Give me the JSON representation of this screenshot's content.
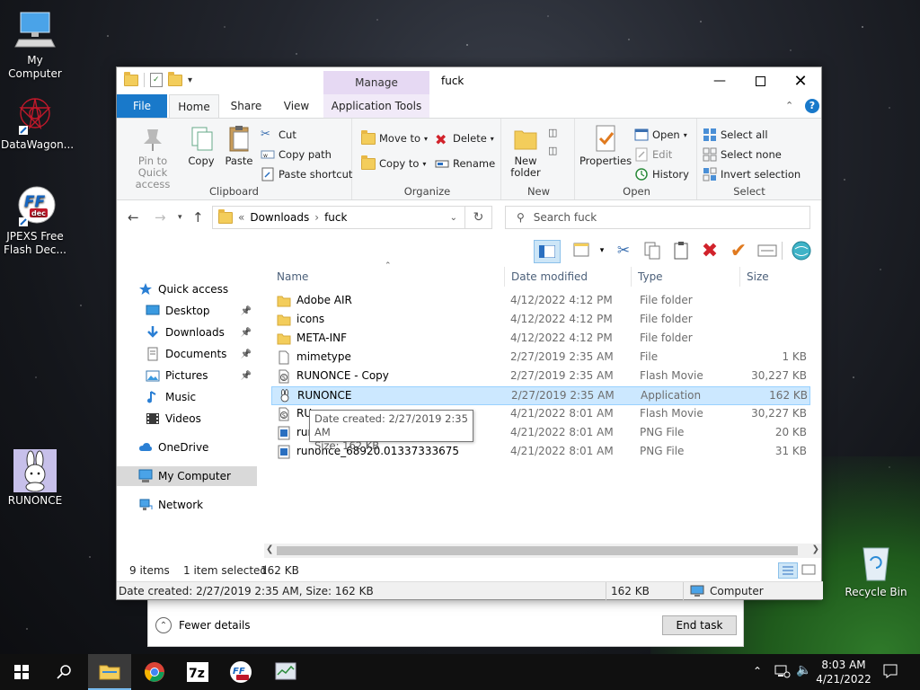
{
  "desktop": {
    "icons": [
      {
        "label": "My Computer",
        "icon": "computer-icon"
      },
      {
        "label": "DataWagon...",
        "icon": "datawagon-icon"
      },
      {
        "label": "JPEXS Free Flash Dec...",
        "icon": "ffdec-icon"
      },
      {
        "label": "RUNONCE",
        "icon": "bunny-icon"
      },
      {
        "label": "Recycle Bin",
        "icon": "recycle-bin-icon"
      }
    ]
  },
  "taskmgr": {
    "fewer_details": "Fewer details",
    "end_task": "End task"
  },
  "window": {
    "title": "fuck",
    "manage": "Manage",
    "tabs": {
      "file": "File",
      "home": "Home",
      "share": "Share",
      "view": "View",
      "app_tools": "Application Tools"
    },
    "ribbon": {
      "clipboard": {
        "label": "Clipboard",
        "pin": "Pin to Quick access",
        "copy": "Copy",
        "paste": "Paste",
        "cut": "Cut",
        "copy_path": "Copy path",
        "paste_shortcut": "Paste shortcut"
      },
      "organize": {
        "label": "Organize",
        "move_to": "Move to",
        "copy_to": "Copy to",
        "delete": "Delete",
        "rename": "Rename"
      },
      "new": {
        "label": "New",
        "new_folder": "New folder"
      },
      "open": {
        "label": "Open",
        "properties": "Properties",
        "open": "Open",
        "edit": "Edit",
        "history": "History"
      },
      "select": {
        "label": "Select",
        "select_all": "Select all",
        "select_none": "Select none",
        "invert": "Invert selection"
      }
    },
    "address": {
      "crumbs": [
        "Downloads",
        "fuck"
      ],
      "search_placeholder": "Search fuck"
    },
    "nav": [
      {
        "label": "Quick access",
        "icon": "star-icon",
        "pinned": false
      },
      {
        "label": "Desktop",
        "icon": "desktop-icon",
        "pinned": true
      },
      {
        "label": "Downloads",
        "icon": "download-icon",
        "pinned": true
      },
      {
        "label": "Documents",
        "icon": "documents-icon",
        "pinned": true
      },
      {
        "label": "Pictures",
        "icon": "pictures-icon",
        "pinned": true
      },
      {
        "label": "Music",
        "icon": "music-icon",
        "pinned": false
      },
      {
        "label": "Videos",
        "icon": "videos-icon",
        "pinned": false
      },
      {
        "label": "OneDrive",
        "icon": "cloud-icon",
        "pinned": false
      },
      {
        "label": "My Computer",
        "icon": "computer-icon",
        "pinned": false
      },
      {
        "label": "Network",
        "icon": "network-icon",
        "pinned": false
      }
    ],
    "columns": {
      "name": "Name",
      "date": "Date modified",
      "type": "Type",
      "size": "Size"
    },
    "files": [
      {
        "name": "Adobe AIR",
        "date": "4/12/2022 4:12 PM",
        "type": "File folder",
        "size": "",
        "icon": "folder-icon"
      },
      {
        "name": "icons",
        "date": "4/12/2022 4:12 PM",
        "type": "File folder",
        "size": "",
        "icon": "folder-icon"
      },
      {
        "name": "META-INF",
        "date": "4/12/2022 4:12 PM",
        "type": "File folder",
        "size": "",
        "icon": "folder-icon"
      },
      {
        "name": "mimetype",
        "date": "2/27/2019 2:35 AM",
        "type": "File",
        "size": "1 KB",
        "icon": "file-icon"
      },
      {
        "name": "RUNONCE - Copy",
        "date": "2/27/2019 2:35 AM",
        "type": "Flash Movie",
        "size": "30,227 KB",
        "icon": "flash-movie-icon"
      },
      {
        "name": "RUNONCE",
        "date": "2/27/2019 2:35 AM",
        "type": "Application",
        "size": "162 KB",
        "icon": "bunny-icon"
      },
      {
        "name": "RU",
        "date": "4/21/2022 8:01 AM",
        "type": "Flash Movie",
        "size": "30,227 KB",
        "icon": "flash-movie-icon"
      },
      {
        "name": "run",
        "date": "4/21/2022 8:01 AM",
        "type": "PNG File",
        "size": "20 KB",
        "icon": "png-icon"
      },
      {
        "name": "runonce_68920.01337333675",
        "date": "4/21/2022 8:01 AM",
        "type": "PNG File",
        "size": "31 KB",
        "icon": "png-icon"
      }
    ],
    "tooltip": {
      "line1": "Date created: 2/27/2019 2:35 AM",
      "line2": "Size: 162 KB"
    },
    "status": {
      "items": "9 items",
      "selected": "1 item selected",
      "size": "162 KB"
    },
    "details": {
      "text": "Date created: 2/27/2019 2:35 AM, Size: 162 KB",
      "size": "162 KB",
      "location": "Computer"
    }
  },
  "taskbar": {
    "time": "8:03 AM",
    "date": "4/21/2022"
  },
  "colors": {
    "accent": "#1979ca",
    "selection": "#cce8ff",
    "manage_tab": "#e6d9f3"
  }
}
